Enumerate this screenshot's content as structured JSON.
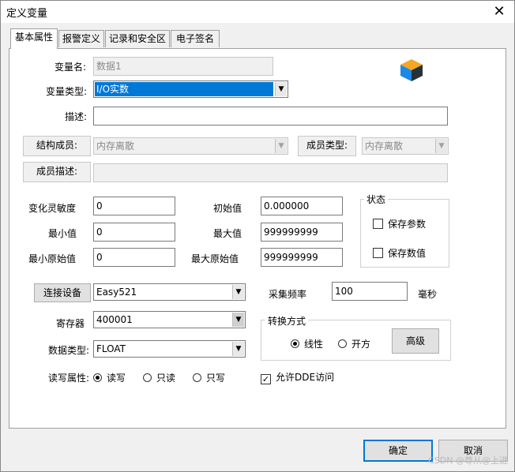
{
  "window": {
    "title": "定义变量",
    "close": "✕"
  },
  "tabs": [
    {
      "label": "基本属性"
    },
    {
      "label": "报警定义"
    },
    {
      "label": "记录和安全区"
    },
    {
      "label": "电子签名"
    }
  ],
  "fields": {
    "var_name_label": "变量名:",
    "var_name_value": "数据1",
    "var_type_label": "变量类型:",
    "var_type_value": "I/O实数",
    "desc_label": "描述:",
    "desc_value": "",
    "struct_member_label": "结构成员:",
    "struct_member_value": "内存离散",
    "member_type_label": "成员类型:",
    "member_type_value": "内存离散",
    "member_desc_label": "成员描述:",
    "member_desc_value": "",
    "sensitivity_label": "变化灵敏度",
    "sensitivity_value": "0",
    "initial_label": "初始值",
    "initial_value": "0.000000",
    "min_label": "最小值",
    "min_value": "0",
    "max_label": "最大值",
    "max_value": "999999999",
    "min_raw_label": "最小原始值",
    "min_raw_value": "0",
    "max_raw_label": "最大原始值",
    "max_raw_value": "999999999"
  },
  "status": {
    "title": "状态",
    "save_params": "保存参数",
    "save_values": "保存数值"
  },
  "device": {
    "connect_button": "连接设备",
    "device_value": "Easy521",
    "freq_label": "采集频率",
    "freq_value": "100",
    "freq_unit": "毫秒",
    "register_label": "寄存器",
    "register_value": "400001",
    "datatype_label": "数据类型:",
    "datatype_value": "FLOAT"
  },
  "conversion": {
    "title": "转换方式",
    "linear": "线性",
    "sqrt": "开方",
    "advanced_button": "高级"
  },
  "rw": {
    "label": "读写属性:",
    "readwrite": "读写",
    "readonly": "只读",
    "writeonly": "只写"
  },
  "dde": {
    "label": "允许DDE访问",
    "checked": "✓"
  },
  "buttons": {
    "ok": "确定",
    "cancel": "取消"
  },
  "watermark": "CSDN @尊从@上进",
  "icons": {
    "dropdown_arrow": "▼",
    "app_icon": "cube-icon"
  }
}
